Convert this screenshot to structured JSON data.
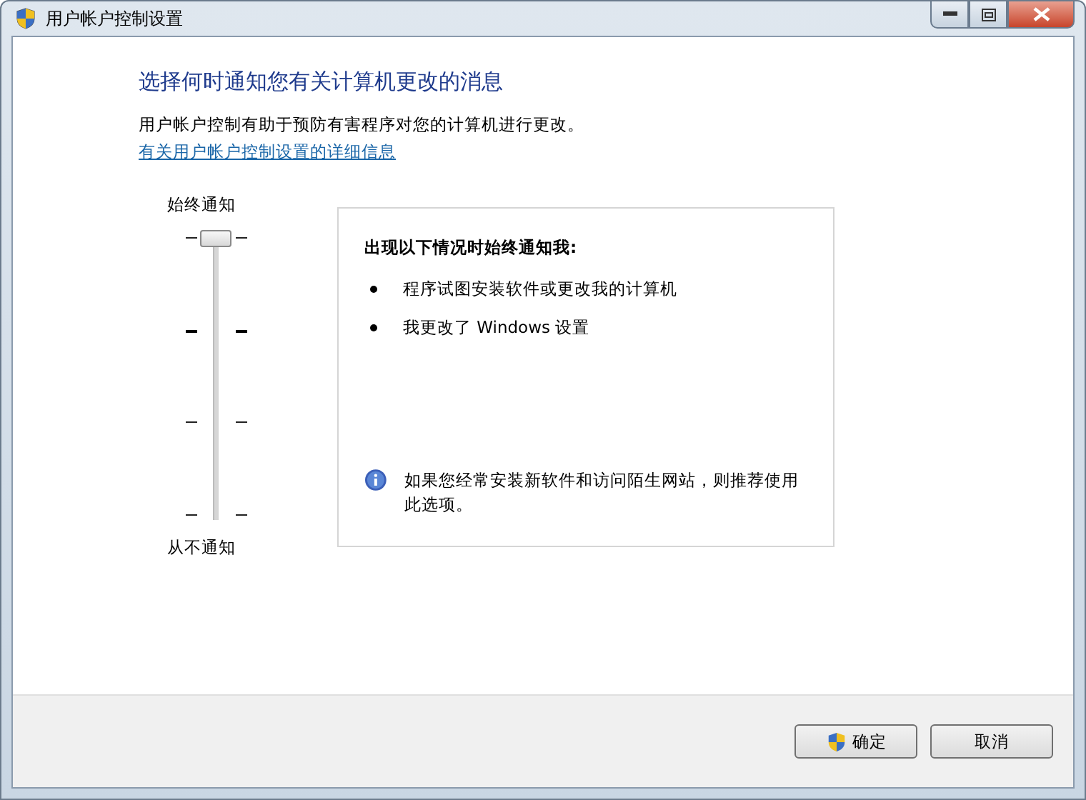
{
  "window": {
    "title": "用户帐户控制设置"
  },
  "heading": "选择何时通知您有关计算机更改的消息",
  "description": "用户帐户控制有助于预防有害程序对您的计算机进行更改。",
  "link": "有关用户帐户控制设置的详细信息",
  "slider": {
    "top_label": "始终通知",
    "bottom_label": "从不通知",
    "level": 1
  },
  "info_panel": {
    "title": "出现以下情况时始终通知我:",
    "bullets": [
      "程序试图安装软件或更改我的计算机",
      "我更改了 Windows 设置"
    ],
    "note": "如果您经常安装新软件和访问陌生网站，则推荐使用此选项。"
  },
  "buttons": [
    {
      "label": "确定",
      "shield": true
    },
    {
      "label": "取消",
      "shield": false
    }
  ]
}
